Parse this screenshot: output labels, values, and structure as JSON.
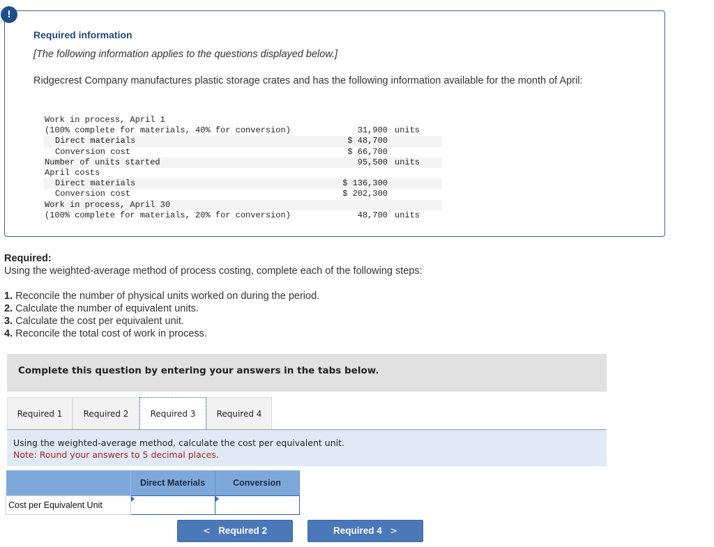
{
  "info": {
    "badge": "!",
    "title": "Required information",
    "subtitle": "[The following information applies to the questions displayed below.]",
    "intro": "Ridgecrest Company manufactures plastic storage crates and has the following information available for the month of April:",
    "rows": [
      {
        "label": "Work in process, April 1",
        "value": "",
        "unit": "",
        "indent": false,
        "shade": false
      },
      {
        "label": "(100% complete for materials, 40% for conversion)",
        "value": "31,900",
        "unit": "units",
        "indent": false,
        "shade": false
      },
      {
        "label": "Direct materials",
        "value": "$ 48,700",
        "unit": "",
        "indent": true,
        "shade": true
      },
      {
        "label": "Conversion cost",
        "value": "$ 66,700",
        "unit": "",
        "indent": true,
        "shade": false
      },
      {
        "label": "Number of units started",
        "value": "95,500",
        "unit": "units",
        "indent": false,
        "shade": true
      },
      {
        "label": "April costs",
        "value": "",
        "unit": "",
        "indent": false,
        "shade": false
      },
      {
        "label": "Direct materials",
        "value": "$ 136,300",
        "unit": "",
        "indent": true,
        "shade": true
      },
      {
        "label": "Conversion cost",
        "value": "$ 202,300",
        "unit": "",
        "indent": true,
        "shade": false
      },
      {
        "label": "Work in process, April 30",
        "value": "",
        "unit": "",
        "indent": false,
        "shade": true
      },
      {
        "label": "(100% complete for materials, 20% for conversion)",
        "value": "48,700",
        "unit": "units",
        "indent": false,
        "shade": false
      }
    ]
  },
  "required": {
    "heading": "Required:",
    "description": "Using the weighted-average method of process costing, complete each of the following steps:",
    "steps": [
      {
        "num": "1.",
        "text": " Reconcile the number of physical units worked on during the period."
      },
      {
        "num": "2.",
        "text": " Calculate the number of equivalent units."
      },
      {
        "num": "3.",
        "text": " Calculate the cost per equivalent unit."
      },
      {
        "num": "4.",
        "text": " Reconcile the total cost of work in process."
      }
    ]
  },
  "complete_bar": "Complete this question by entering your answers in the tabs below.",
  "tabs": [
    {
      "label": "Required 1",
      "active": false
    },
    {
      "label": "Required 2",
      "active": false
    },
    {
      "label": "Required 3",
      "active": true
    },
    {
      "label": "Required 4",
      "active": false
    }
  ],
  "instructions": {
    "line1": "Using the weighted-average method, calculate the cost per equivalent unit.",
    "note": "Note: Round your answers to 5 decimal places."
  },
  "answer_table": {
    "headers": [
      "",
      "Direct Materials",
      "Conversion"
    ],
    "row_label": "Cost per Equivalent Unit",
    "values": [
      "",
      ""
    ]
  },
  "nav": {
    "prev_label": "Required 2",
    "next_label": "Required 4",
    "prev_icon": "chevron-left-icon",
    "next_icon": "chevron-right-icon"
  }
}
